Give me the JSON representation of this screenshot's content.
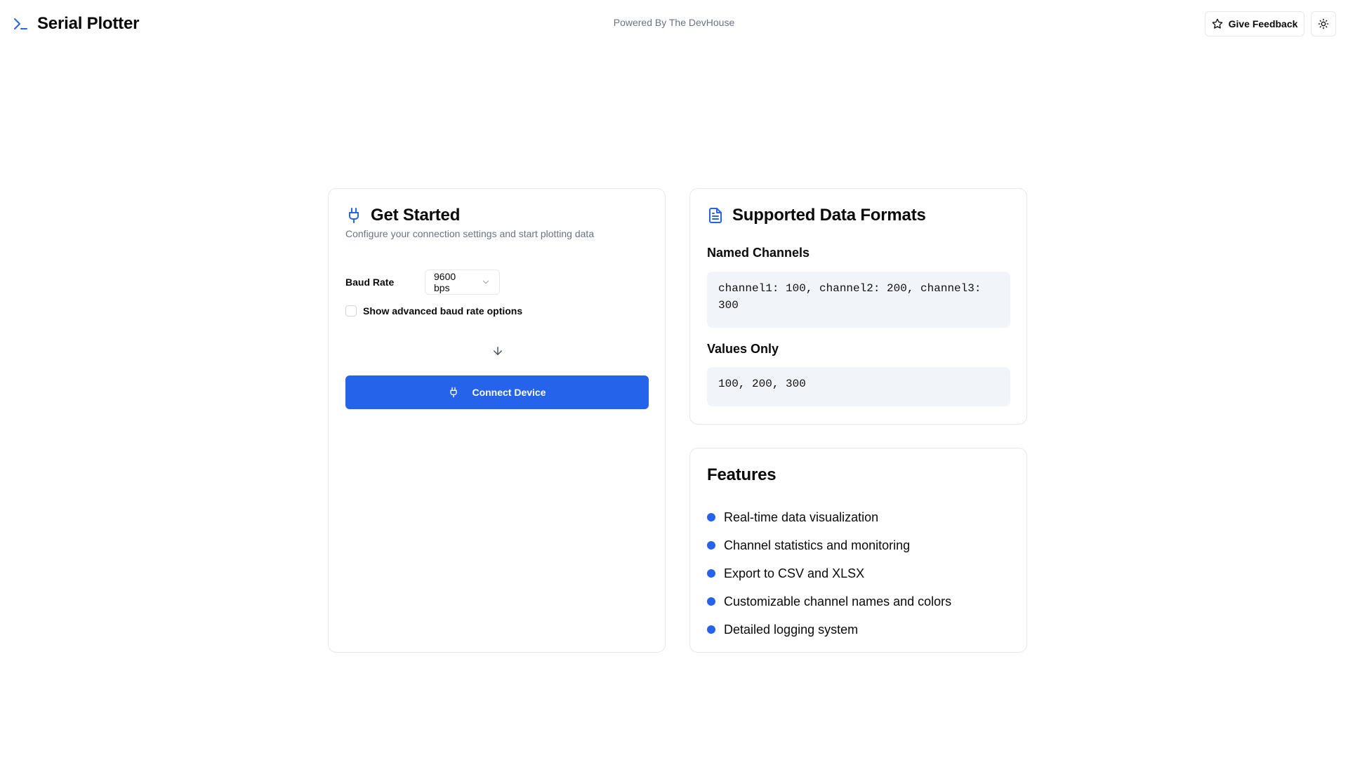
{
  "header": {
    "title": "Serial Plotter",
    "powered_by": "Powered By The DevHouse",
    "feedback_label": "Give Feedback"
  },
  "get_started": {
    "title": "Get Started",
    "description": "Configure your connection settings and start plotting data",
    "baud_label": "Baud Rate",
    "baud_value": "9600 bps",
    "advanced_label": "Show advanced baud rate options",
    "advanced_checked": false,
    "connect_label": "Connect Device"
  },
  "formats": {
    "title": "Supported Data Formats",
    "named_heading": "Named Channels",
    "named_example": "channel1: 100, channel2: 200, channel3: 300",
    "values_heading": "Values Only",
    "values_example": "100, 200, 300"
  },
  "features": {
    "title": "Features",
    "items": [
      "Real-time data visualization",
      "Channel statistics and monitoring",
      "Export to CSV and XLSX",
      "Customizable channel names and colors",
      "Detailed logging system"
    ]
  },
  "colors": {
    "accent": "#2563eb",
    "muted_text": "#6b7280",
    "border": "#e5e7eb",
    "code_bg": "#f1f4f8"
  },
  "icons": {
    "brand": "terminal-icon",
    "feedback": "star-icon",
    "theme": "sun-icon",
    "get_started": "plug-icon",
    "baud_select": "chevron-down-icon",
    "flow": "arrow-down-icon",
    "connect": "plug-icon",
    "formats": "file-text-icon"
  }
}
